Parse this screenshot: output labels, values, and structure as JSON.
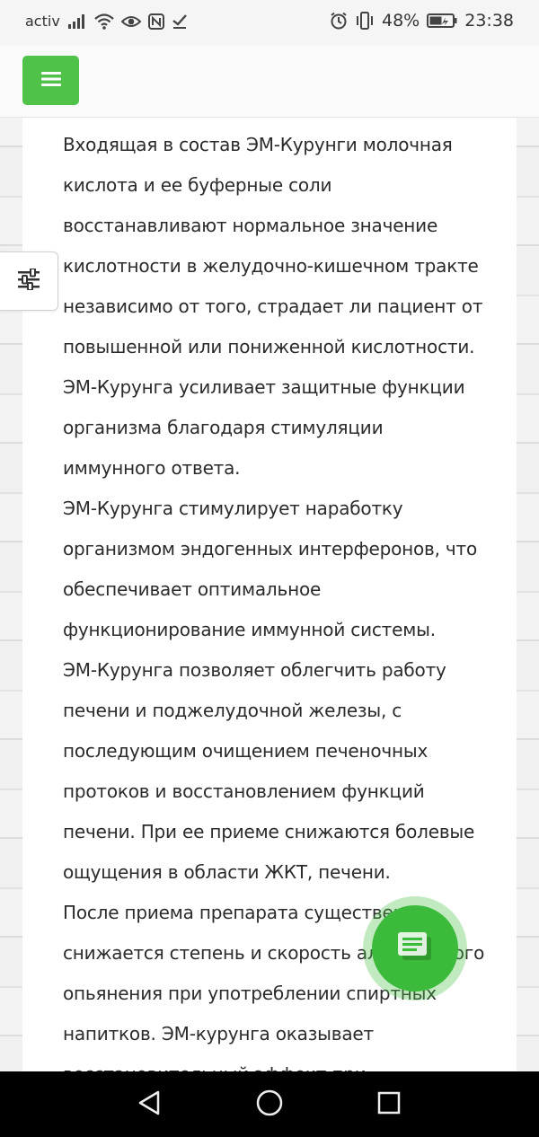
{
  "status_bar": {
    "carrier": "activ",
    "battery": "48%",
    "time": "23:38",
    "icons": [
      "signal-icon",
      "wifi-icon",
      "eye-icon",
      "nfc-icon",
      "check-icon",
      "alarm-icon",
      "vibrate-icon",
      "battery-icon"
    ]
  },
  "header": {
    "menu_icon": "hamburger-icon"
  },
  "article": {
    "paragraphs": [
      "Входящая в состав ЭМ-Курунги молочная кислота и ее буферные соли восстанавливают нормальное значение кислотности в желудочно-кишечном тракте независимо от того, страдает ли пациент от повышенной или пониженной кислотности.",
      "ЭМ-Курунга усиливает защитные функции организма благодаря стимуляции иммунного ответа.",
      "ЭМ-Курунга стимулирует наработку организмом эндогенных интерферонов, что обеспечивает оптимальное функционирование иммунной системы.",
      "ЭМ-Курунга позволяет облегчить работу печени и поджелудочной железы, с последующим очищением печеночных протоков и восстановлением функций печени. При ее приеме снижаются болевые ощущения в области ЖКТ, печени.",
      "После приема препарата существенно снижается степень и скорость алкогольного опьянения при употреблении спиртных напитков. ЭМ-курунга оказывает восстановительный эффект при"
    ]
  },
  "colors": {
    "accent": "#4fc24a",
    "chat": "#3cba3b"
  },
  "floating": {
    "filter_icon": "sliders-icon",
    "chat_icon": "chat-icon"
  },
  "nav": {
    "icons": [
      "back-icon",
      "home-icon",
      "recents-icon"
    ]
  }
}
